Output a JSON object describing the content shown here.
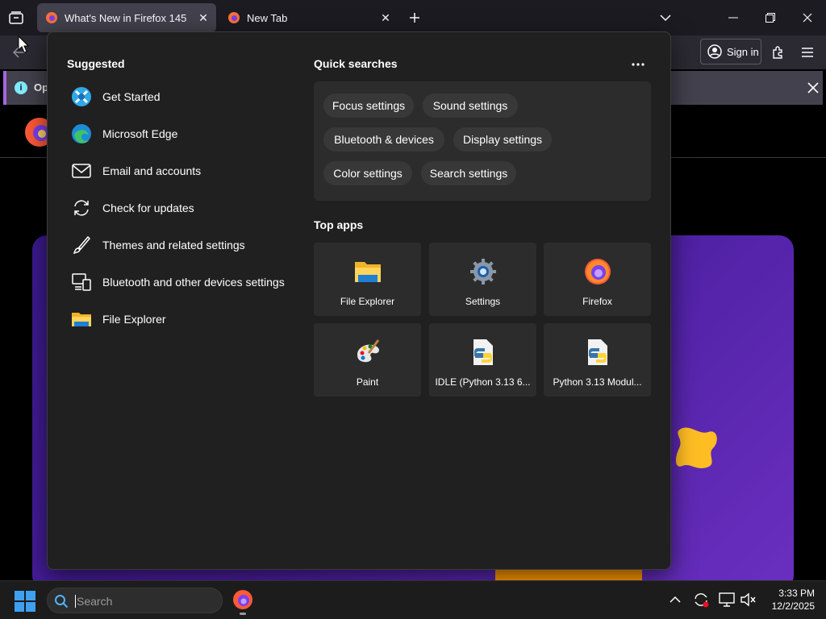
{
  "browser": {
    "tabs": [
      {
        "title": "What's New in Firefox 145",
        "active": true
      },
      {
        "title": "New Tab",
        "active": false
      }
    ],
    "sign_in_label": "Sign in",
    "notification_text": "Ope"
  },
  "start_menu": {
    "suggested_title": "Suggested",
    "suggested": [
      {
        "label": "Get Started",
        "icon": "get-started-icon"
      },
      {
        "label": "Microsoft Edge",
        "icon": "edge-icon"
      },
      {
        "label": "Email and accounts",
        "icon": "mail-icon"
      },
      {
        "label": "Check for updates",
        "icon": "sync-icon"
      },
      {
        "label": "Themes and related settings",
        "icon": "brush-icon"
      },
      {
        "label": "Bluetooth and other devices settings",
        "icon": "devices-icon"
      },
      {
        "label": "File Explorer",
        "icon": "folder-icon"
      }
    ],
    "quick_searches_title": "Quick searches",
    "quick_searches": [
      "Focus settings",
      "Sound settings",
      "Bluetooth & devices",
      "Display settings",
      "Color settings",
      "Search settings"
    ],
    "top_apps_title": "Top apps",
    "top_apps": [
      {
        "label": "File Explorer",
        "icon": "folder-icon"
      },
      {
        "label": "Settings",
        "icon": "settings-gear-icon"
      },
      {
        "label": "Firefox",
        "icon": "firefox-icon"
      },
      {
        "label": "Paint",
        "icon": "paint-palette-icon"
      },
      {
        "label": "IDLE (Python 3.13 6...",
        "icon": "python-file-icon"
      },
      {
        "label": "Python 3.13 Modul...",
        "icon": "python-file-icon"
      }
    ]
  },
  "taskbar": {
    "search_placeholder": "Search",
    "time": "3:33 PM",
    "date": "12/2/2025"
  },
  "colors": {
    "panel_bg": "#202020",
    "tile_bg": "#2c2c2c",
    "chip_bg": "#383838",
    "accent_purple": "#a466e0",
    "hero_purple": "#4a1e9e"
  }
}
